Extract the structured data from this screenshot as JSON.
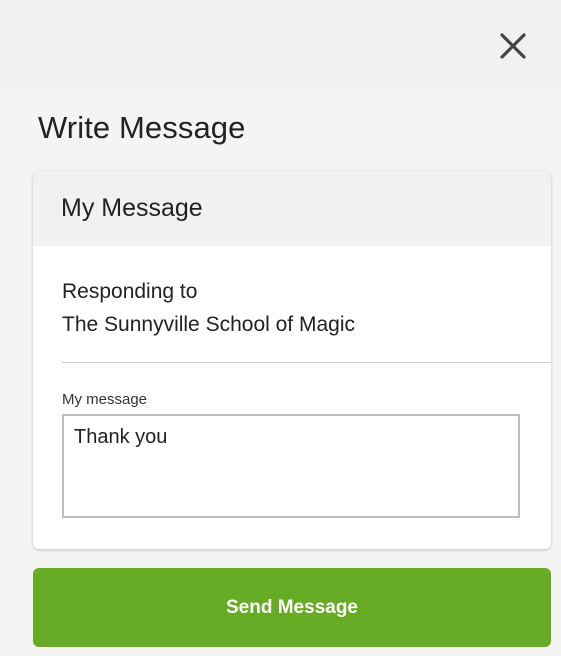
{
  "header": {
    "close_icon": "close-icon"
  },
  "page": {
    "title": "Write Message"
  },
  "card": {
    "title": "My Message",
    "responding_label": "Responding to",
    "responding_to": "The Sunnyville School of Magic",
    "message_label": "My message",
    "message_value": "Thank you"
  },
  "actions": {
    "send_label": "Send Message"
  },
  "colors": {
    "accent": "#67ab24",
    "background": "#f4f4f4",
    "card": "#ffffff",
    "header_band": "#f1f1f1"
  }
}
